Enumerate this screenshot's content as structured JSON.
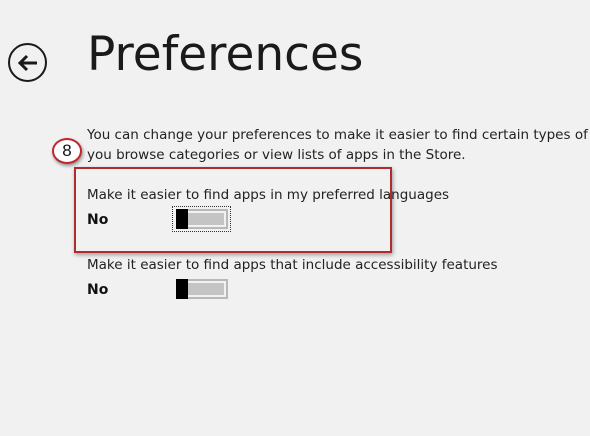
{
  "header": {
    "title": "Preferences",
    "back_icon": "back-arrow-icon"
  },
  "description": {
    "line1": "You can change your preferences to make it easier to find certain types of ap",
    "line2": "you browse categories or view lists of apps in the Store."
  },
  "settings": [
    {
      "label": "Make it easier to find apps in my preferred languages",
      "value": "No",
      "on": false,
      "focused": true
    },
    {
      "label": "Make it easier to find apps that include accessibility features",
      "value": "No",
      "on": false,
      "focused": false
    }
  ],
  "annotation": {
    "step_number": "8",
    "color": "#b02a30"
  },
  "colors": {
    "background": "#f1f1f1",
    "text": "#1a1a1a",
    "toggle_thumb": "#000000",
    "toggle_track": "#c4c4c4"
  }
}
